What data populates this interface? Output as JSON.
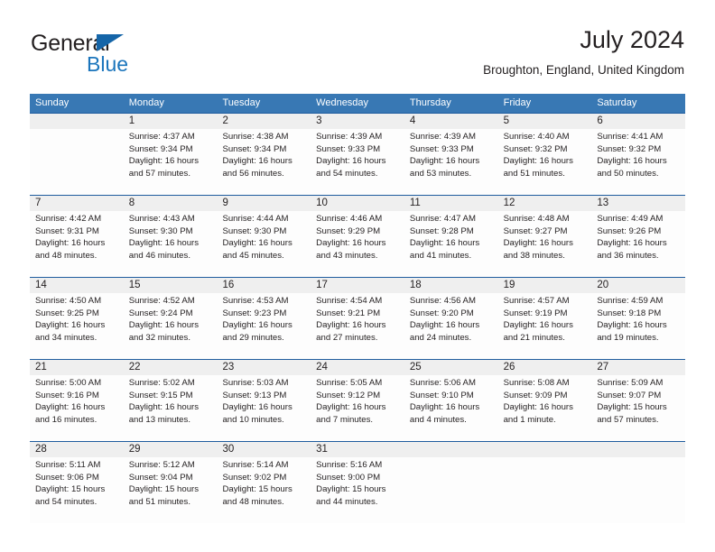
{
  "brand": {
    "name_primary": "General",
    "name_secondary": "Blue",
    "logo_icon": "triangle-flag-icon"
  },
  "header": {
    "title": "July 2024",
    "location": "Broughton, England, United Kingdom"
  },
  "colors": {
    "header_blue": "#3878b4",
    "divider_blue": "#1f5c9e",
    "brand_blue": "#1b75bc",
    "date_band": "#efefef",
    "text": "#231f20"
  },
  "calendar": {
    "day_headers": [
      "Sunday",
      "Monday",
      "Tuesday",
      "Wednesday",
      "Thursday",
      "Friday",
      "Saturday"
    ],
    "weeks": [
      {
        "days": [
          {
            "num": "",
            "l1": "",
            "l2": "",
            "l3": "",
            "l4": ""
          },
          {
            "num": "1",
            "l1": "Sunrise: 4:37 AM",
            "l2": "Sunset: 9:34 PM",
            "l3": "Daylight: 16 hours",
            "l4": "and 57 minutes."
          },
          {
            "num": "2",
            "l1": "Sunrise: 4:38 AM",
            "l2": "Sunset: 9:34 PM",
            "l3": "Daylight: 16 hours",
            "l4": "and 56 minutes."
          },
          {
            "num": "3",
            "l1": "Sunrise: 4:39 AM",
            "l2": "Sunset: 9:33 PM",
            "l3": "Daylight: 16 hours",
            "l4": "and 54 minutes."
          },
          {
            "num": "4",
            "l1": "Sunrise: 4:39 AM",
            "l2": "Sunset: 9:33 PM",
            "l3": "Daylight: 16 hours",
            "l4": "and 53 minutes."
          },
          {
            "num": "5",
            "l1": "Sunrise: 4:40 AM",
            "l2": "Sunset: 9:32 PM",
            "l3": "Daylight: 16 hours",
            "l4": "and 51 minutes."
          },
          {
            "num": "6",
            "l1": "Sunrise: 4:41 AM",
            "l2": "Sunset: 9:32 PM",
            "l3": "Daylight: 16 hours",
            "l4": "and 50 minutes."
          }
        ]
      },
      {
        "days": [
          {
            "num": "7",
            "l1": "Sunrise: 4:42 AM",
            "l2": "Sunset: 9:31 PM",
            "l3": "Daylight: 16 hours",
            "l4": "and 48 minutes."
          },
          {
            "num": "8",
            "l1": "Sunrise: 4:43 AM",
            "l2": "Sunset: 9:30 PM",
            "l3": "Daylight: 16 hours",
            "l4": "and 46 minutes."
          },
          {
            "num": "9",
            "l1": "Sunrise: 4:44 AM",
            "l2": "Sunset: 9:30 PM",
            "l3": "Daylight: 16 hours",
            "l4": "and 45 minutes."
          },
          {
            "num": "10",
            "l1": "Sunrise: 4:46 AM",
            "l2": "Sunset: 9:29 PM",
            "l3": "Daylight: 16 hours",
            "l4": "and 43 minutes."
          },
          {
            "num": "11",
            "l1": "Sunrise: 4:47 AM",
            "l2": "Sunset: 9:28 PM",
            "l3": "Daylight: 16 hours",
            "l4": "and 41 minutes."
          },
          {
            "num": "12",
            "l1": "Sunrise: 4:48 AM",
            "l2": "Sunset: 9:27 PM",
            "l3": "Daylight: 16 hours",
            "l4": "and 38 minutes."
          },
          {
            "num": "13",
            "l1": "Sunrise: 4:49 AM",
            "l2": "Sunset: 9:26 PM",
            "l3": "Daylight: 16 hours",
            "l4": "and 36 minutes."
          }
        ]
      },
      {
        "days": [
          {
            "num": "14",
            "l1": "Sunrise: 4:50 AM",
            "l2": "Sunset: 9:25 PM",
            "l3": "Daylight: 16 hours",
            "l4": "and 34 minutes."
          },
          {
            "num": "15",
            "l1": "Sunrise: 4:52 AM",
            "l2": "Sunset: 9:24 PM",
            "l3": "Daylight: 16 hours",
            "l4": "and 32 minutes."
          },
          {
            "num": "16",
            "l1": "Sunrise: 4:53 AM",
            "l2": "Sunset: 9:23 PM",
            "l3": "Daylight: 16 hours",
            "l4": "and 29 minutes."
          },
          {
            "num": "17",
            "l1": "Sunrise: 4:54 AM",
            "l2": "Sunset: 9:21 PM",
            "l3": "Daylight: 16 hours",
            "l4": "and 27 minutes."
          },
          {
            "num": "18",
            "l1": "Sunrise: 4:56 AM",
            "l2": "Sunset: 9:20 PM",
            "l3": "Daylight: 16 hours",
            "l4": "and 24 minutes."
          },
          {
            "num": "19",
            "l1": "Sunrise: 4:57 AM",
            "l2": "Sunset: 9:19 PM",
            "l3": "Daylight: 16 hours",
            "l4": "and 21 minutes."
          },
          {
            "num": "20",
            "l1": "Sunrise: 4:59 AM",
            "l2": "Sunset: 9:18 PM",
            "l3": "Daylight: 16 hours",
            "l4": "and 19 minutes."
          }
        ]
      },
      {
        "days": [
          {
            "num": "21",
            "l1": "Sunrise: 5:00 AM",
            "l2": "Sunset: 9:16 PM",
            "l3": "Daylight: 16 hours",
            "l4": "and 16 minutes."
          },
          {
            "num": "22",
            "l1": "Sunrise: 5:02 AM",
            "l2": "Sunset: 9:15 PM",
            "l3": "Daylight: 16 hours",
            "l4": "and 13 minutes."
          },
          {
            "num": "23",
            "l1": "Sunrise: 5:03 AM",
            "l2": "Sunset: 9:13 PM",
            "l3": "Daylight: 16 hours",
            "l4": "and 10 minutes."
          },
          {
            "num": "24",
            "l1": "Sunrise: 5:05 AM",
            "l2": "Sunset: 9:12 PM",
            "l3": "Daylight: 16 hours",
            "l4": "and 7 minutes."
          },
          {
            "num": "25",
            "l1": "Sunrise: 5:06 AM",
            "l2": "Sunset: 9:10 PM",
            "l3": "Daylight: 16 hours",
            "l4": "and 4 minutes."
          },
          {
            "num": "26",
            "l1": "Sunrise: 5:08 AM",
            "l2": "Sunset: 9:09 PM",
            "l3": "Daylight: 16 hours",
            "l4": "and 1 minute."
          },
          {
            "num": "27",
            "l1": "Sunrise: 5:09 AM",
            "l2": "Sunset: 9:07 PM",
            "l3": "Daylight: 15 hours",
            "l4": "and 57 minutes."
          }
        ]
      },
      {
        "days": [
          {
            "num": "28",
            "l1": "Sunrise: 5:11 AM",
            "l2": "Sunset: 9:06 PM",
            "l3": "Daylight: 15 hours",
            "l4": "and 54 minutes."
          },
          {
            "num": "29",
            "l1": "Sunrise: 5:12 AM",
            "l2": "Sunset: 9:04 PM",
            "l3": "Daylight: 15 hours",
            "l4": "and 51 minutes."
          },
          {
            "num": "30",
            "l1": "Sunrise: 5:14 AM",
            "l2": "Sunset: 9:02 PM",
            "l3": "Daylight: 15 hours",
            "l4": "and 48 minutes."
          },
          {
            "num": "31",
            "l1": "Sunrise: 5:16 AM",
            "l2": "Sunset: 9:00 PM",
            "l3": "Daylight: 15 hours",
            "l4": "and 44 minutes."
          },
          {
            "num": "",
            "l1": "",
            "l2": "",
            "l3": "",
            "l4": ""
          },
          {
            "num": "",
            "l1": "",
            "l2": "",
            "l3": "",
            "l4": ""
          },
          {
            "num": "",
            "l1": "",
            "l2": "",
            "l3": "",
            "l4": ""
          }
        ]
      }
    ]
  }
}
